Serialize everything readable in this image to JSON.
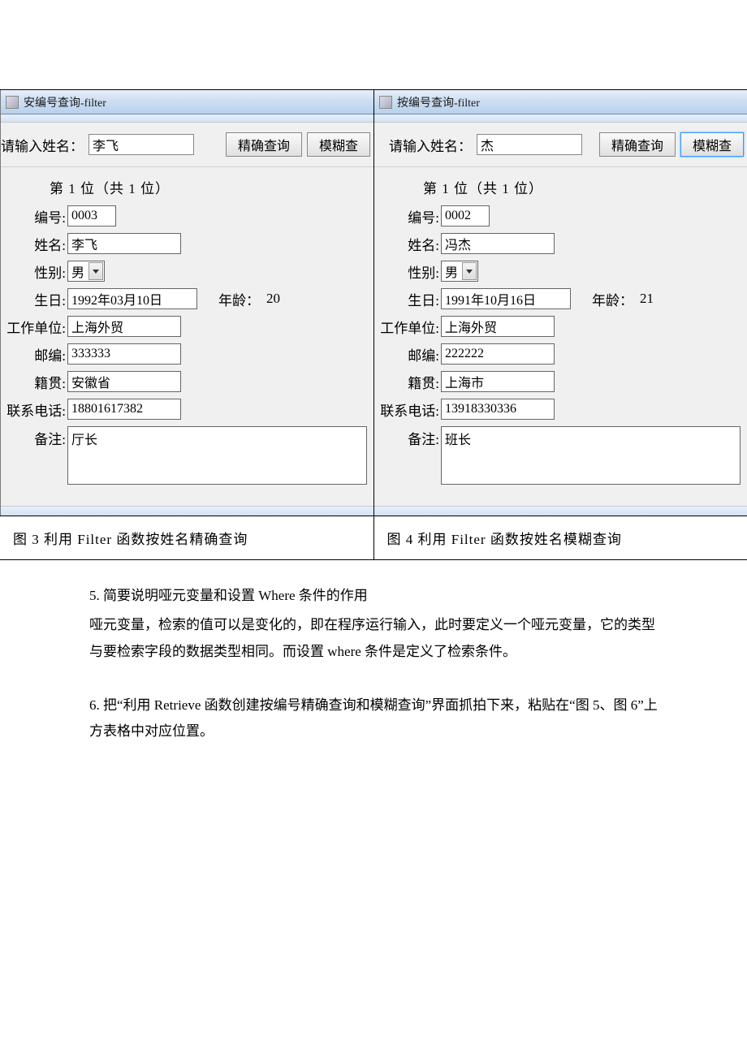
{
  "window_left": {
    "title": "安编号查询-filter",
    "search_label": "请输入姓名：",
    "search_value": "李飞",
    "btn_exact": "精确查询",
    "btn_fuzzy": "模糊查",
    "position": "第 1 位（共 1 位）",
    "labels": {
      "id": "编号:",
      "name": "姓名:",
      "gender": "性别:",
      "birthday": "生日:",
      "age": "年龄：",
      "workunit": "工作单位:",
      "zip": "邮编:",
      "origin": "籍贯:",
      "phone": "联系电话:",
      "remark": "备注:"
    },
    "values": {
      "id": "0003",
      "name": "李飞",
      "gender": "男",
      "birthday": "1992年03月10日",
      "age": "20",
      "workunit": "上海外贸",
      "zip": "333333",
      "origin": "安徽省",
      "phone": "18801617382",
      "remark": "厅长"
    }
  },
  "window_right": {
    "title": "按编号查询-filter",
    "search_label": "请输入姓名：",
    "search_value": "杰",
    "btn_exact": "精确查询",
    "btn_fuzzy": "模糊查",
    "position": "第 1 位（共 1 位）",
    "labels": {
      "id": "编号:",
      "name": "姓名:",
      "gender": "性别:",
      "birthday": "生日:",
      "age": "年龄：",
      "workunit": "工作单位:",
      "zip": "邮编:",
      "origin": "籍贯:",
      "phone": "联系电话:",
      "remark": "备注:"
    },
    "values": {
      "id": "0002",
      "name": "冯杰",
      "gender": "男",
      "birthday": "1991年10月16日",
      "age": "21",
      "workunit": "上海外贸",
      "zip": "222222",
      "origin": "上海市",
      "phone": "13918330336",
      "remark": "班长"
    }
  },
  "captions": {
    "left": "图 3  利用 Filter 函数按姓名精确查询",
    "right": "图 4  利用 Filter 函数按姓名模糊查询"
  },
  "text": {
    "q5_title": "5.  简要说明哑元变量和设置 Where 条件的作用",
    "q5_body": "哑元变量，检索的值可以是变化的，即在程序运行输入，此时要定义一个哑元变量，它的类型与要检索字段的数据类型相同。而设置 where 条件是定义了检索条件。",
    "q6_title": "6.  把“利用 Retrieve 函数创建按编号精确查询和模糊查询”界面抓拍下来，粘贴在“图 5、图 6”上方表格中对应位置。"
  }
}
